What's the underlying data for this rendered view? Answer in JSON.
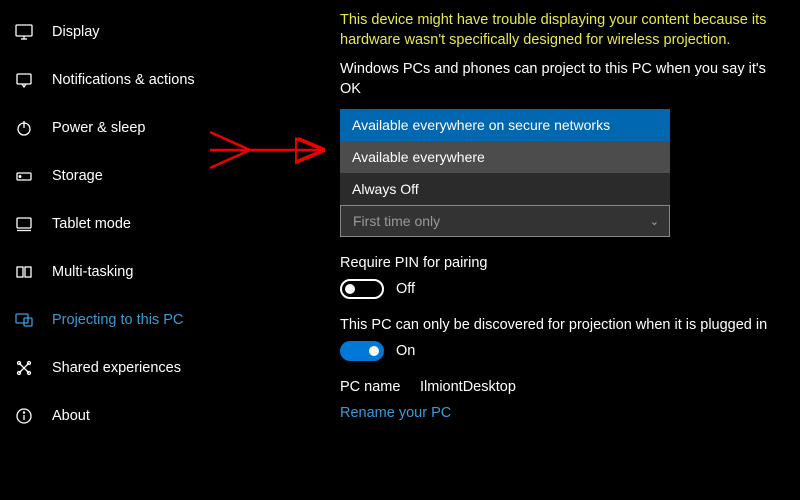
{
  "sidebar": {
    "items": [
      {
        "label": "Display"
      },
      {
        "label": "Notifications & actions"
      },
      {
        "label": "Power & sleep"
      },
      {
        "label": "Storage"
      },
      {
        "label": "Tablet mode"
      },
      {
        "label": "Multi-tasking"
      },
      {
        "label": "Projecting to this PC"
      },
      {
        "label": "Shared experiences"
      },
      {
        "label": "About"
      }
    ]
  },
  "content": {
    "warning": "This device might have trouble displaying your content because its hardware wasn't specifically designed for wireless projection.",
    "desc1": "Windows PCs and phones can project to this PC when you say it's OK",
    "dropdown": {
      "option_selected": "Available everywhere on secure networks",
      "option_hover": "Available everywhere",
      "option_normal": "Always Off"
    },
    "dropdown2_collapsed": "First time only",
    "pin_label": "Require PIN for pairing",
    "pin_state": "Off",
    "discover_label": "This PC can only be discovered for projection when it is plugged in",
    "discover_state": "On",
    "pc_name_label": "PC name",
    "pc_name_value": "IlmiontDesktop",
    "rename_link": "Rename your PC"
  }
}
